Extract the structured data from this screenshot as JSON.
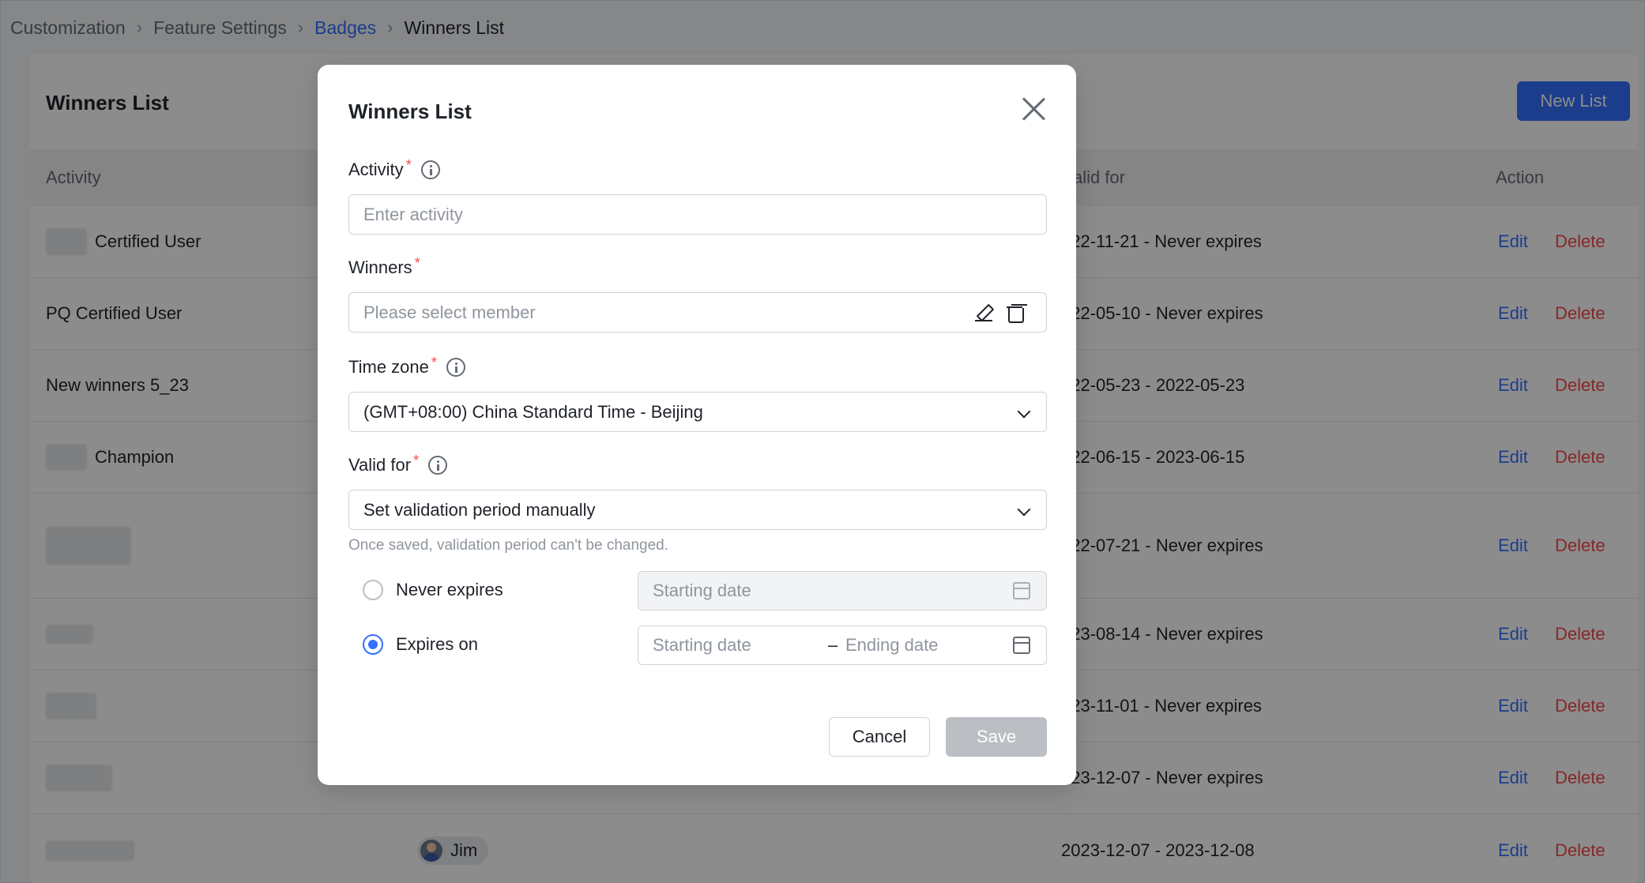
{
  "breadcrumb": {
    "items": [
      "Customization",
      "Feature Settings",
      "Badges",
      "Winners List"
    ]
  },
  "card": {
    "title": "Winners List",
    "new_list_label": "New List"
  },
  "table": {
    "headers": {
      "activity": "Activity",
      "valid_for": "alid for",
      "action": "Action"
    },
    "rows": [
      {
        "activity": "Certified User",
        "valid": "022-11-21 - Never expires",
        "edit": "Edit",
        "delete": "Delete"
      },
      {
        "activity": "PQ Certified User",
        "valid": "022-05-10 - Never expires",
        "edit": "Edit",
        "delete": "Delete"
      },
      {
        "activity": "New winners 5_23",
        "valid": "022-05-23 - 2022-05-23",
        "edit": "Edit",
        "delete": "Delete"
      },
      {
        "activity": "Champion",
        "valid": "022-06-15 - 2023-06-15",
        "edit": "Edit",
        "delete": "Delete"
      },
      {
        "activity": "",
        "valid": "022-07-21 - Never expires",
        "edit": "Edit",
        "delete": "Delete"
      },
      {
        "activity": "",
        "valid": "023-08-14 - Never expires",
        "edit": "Edit",
        "delete": "Delete"
      },
      {
        "activity": "",
        "valid": "023-11-01 - Never expires",
        "edit": "Edit",
        "delete": "Delete"
      },
      {
        "activity": "",
        "valid": "023-12-07 - Never expires",
        "edit": "Edit",
        "delete": "Delete"
      },
      {
        "activity": "",
        "winner": "Jim",
        "valid": "2023-12-07 - 2023-12-08",
        "edit": "Edit",
        "delete": "Delete"
      }
    ]
  },
  "modal": {
    "title": "Winners List",
    "activity": {
      "label": "Activity",
      "required": "*",
      "placeholder": "Enter activity"
    },
    "winners": {
      "label": "Winners",
      "required": "*",
      "placeholder": "Please select member"
    },
    "timezone": {
      "label": "Time zone",
      "required": "*",
      "value": "(GMT+08:00) China Standard Time - Beijing"
    },
    "valid_for": {
      "label": "Valid for",
      "required": "*",
      "value": "Set validation period manually",
      "hint": "Once saved, validation period can't be changed."
    },
    "never_expires": {
      "label": "Never expires",
      "start_placeholder": "Starting date"
    },
    "expires_on": {
      "label": "Expires on",
      "start_placeholder": "Starting date",
      "dash": "–",
      "end_placeholder": "Ending date"
    },
    "cancel_label": "Cancel",
    "save_label": "Save"
  }
}
